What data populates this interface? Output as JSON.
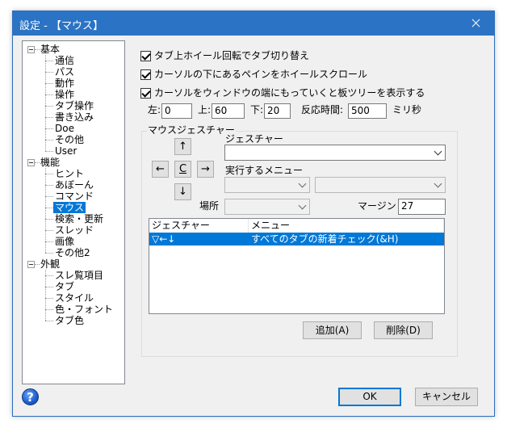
{
  "window": {
    "title": "設定 - 【マウス】"
  },
  "tree": [
    {
      "label": "基本",
      "level": 0,
      "expanded": true
    },
    {
      "label": "通信",
      "level": 1
    },
    {
      "label": "パス",
      "level": 1
    },
    {
      "label": "動作",
      "level": 1
    },
    {
      "label": "操作",
      "level": 1
    },
    {
      "label": "タブ操作",
      "level": 1
    },
    {
      "label": "書き込み",
      "level": 1
    },
    {
      "label": "Doe",
      "level": 1
    },
    {
      "label": "その他",
      "level": 1
    },
    {
      "label": "User",
      "level": 1
    },
    {
      "label": "機能",
      "level": 0,
      "expanded": true
    },
    {
      "label": "ヒント",
      "level": 1
    },
    {
      "label": "あぼーん",
      "level": 1
    },
    {
      "label": "コマンド",
      "level": 1
    },
    {
      "label": "マウス",
      "level": 1,
      "selected": true
    },
    {
      "label": "検索・更新",
      "level": 1
    },
    {
      "label": "スレッド",
      "level": 1
    },
    {
      "label": "画像",
      "level": 1
    },
    {
      "label": "その他2",
      "level": 1
    },
    {
      "label": "外観",
      "level": 0,
      "expanded": true
    },
    {
      "label": "スレ覧項目",
      "level": 1
    },
    {
      "label": "タブ",
      "level": 1
    },
    {
      "label": "スタイル",
      "level": 1
    },
    {
      "label": "色・フォント",
      "level": 1
    },
    {
      "label": "タブ色",
      "level": 1
    }
  ],
  "options": {
    "wheel_tab_switch": {
      "label": "タブ上ホイール回転でタブ切り替え",
      "checked": true
    },
    "wheel_scroll_pane": {
      "label": "カーソルの下にあるペインをホイールスクロール",
      "checked": true
    },
    "board_tree_edge": {
      "label": "カーソルをウィンドウの端にもっていくと板ツリーを表示する",
      "checked": true
    }
  },
  "edge": {
    "left_label": "左:",
    "left_value": "0",
    "top_label": "上:",
    "top_value": "60",
    "bottom_label": "下:",
    "bottom_value": "20",
    "reaction_label": "反応時間:",
    "reaction_value": "500",
    "unit": "ミリ秒"
  },
  "gesture": {
    "group_title": "マウスジェスチャー",
    "up": "↑",
    "left": "←",
    "center": "C",
    "right": "→",
    "down": "↓",
    "gesture_label": "ジェスチャー",
    "gesture_value": "",
    "menu_label": "実行するメニュー",
    "menu_value_1": "",
    "menu_value_2": "",
    "place_label": "場所",
    "place_value": "",
    "margin_label": "マージン",
    "margin_value": "27",
    "columns": [
      "ジェスチャー",
      "メニュー"
    ],
    "rows": [
      {
        "gesture": "▽←↓",
        "menu": "すべてのタブの新着チェック(&H)"
      }
    ],
    "add_button": "追加(A)",
    "delete_button": "削除(D)"
  },
  "footer": {
    "help_icon": "?",
    "ok_button": "OK",
    "cancel_button": "キャンセル"
  },
  "colors": {
    "titlebar": "#2b73c4",
    "selection": "#0078d7",
    "dialog_bg": "#f0f0f0"
  }
}
